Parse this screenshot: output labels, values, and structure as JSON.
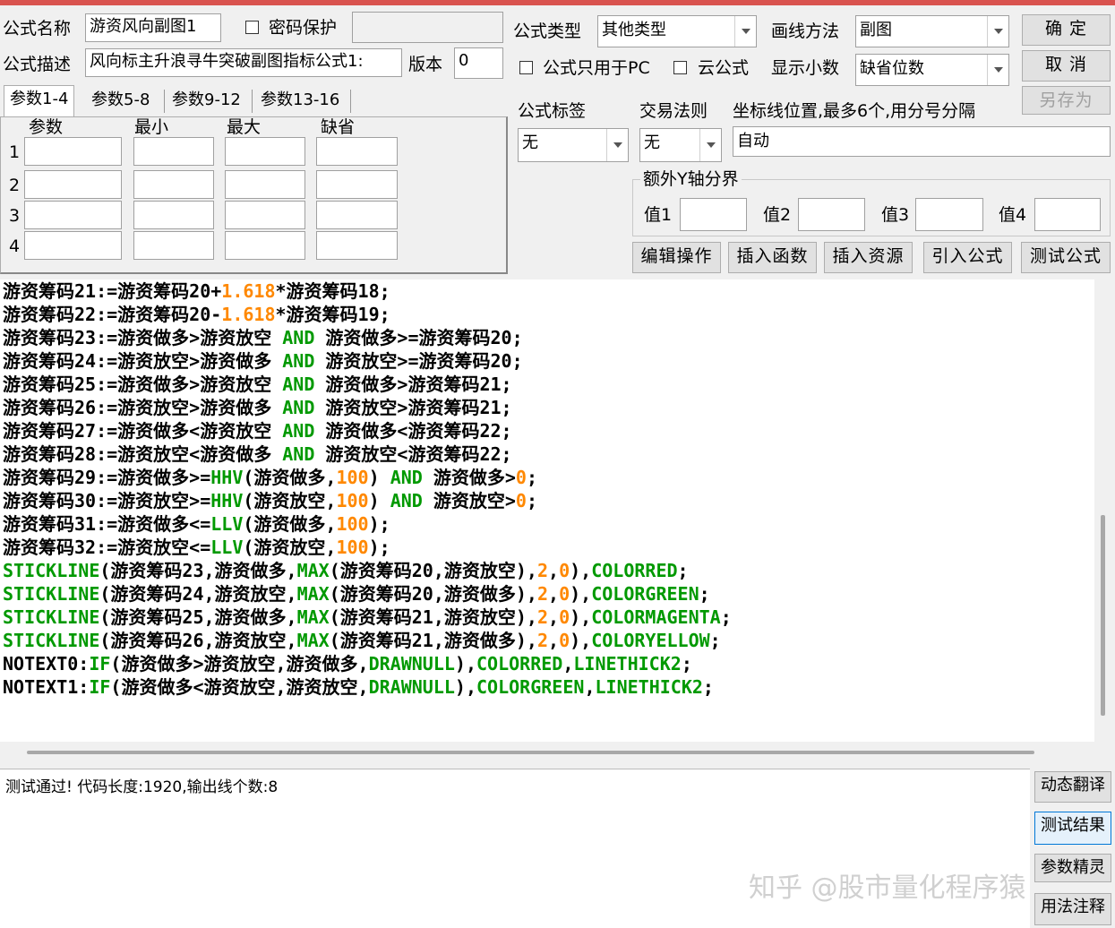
{
  "form": {
    "name_label": "公式名称",
    "name_value": "游资风向副图1",
    "password_label": "密码保护",
    "desc_label": "公式描述",
    "desc_value": "风向标主升浪寻牛突破副图指标公式1:",
    "version_label": "版本",
    "version_value": "0",
    "type_label": "公式类型",
    "type_value": "其他类型",
    "draw_label": "画线方法",
    "draw_value": "副图",
    "pc_only_label": "公式只用于PC",
    "cloud_label": "云公式",
    "decimals_label": "显示小数",
    "decimals_value": "缺省位数",
    "tag_label": "公式标签",
    "tag_value": "无",
    "trade_label": "交易法则",
    "trade_value": "无",
    "axis_label": "坐标线位置,最多6个,用分号分隔",
    "axis_value": "自动",
    "yaxis_group_label": "额外Y轴分界",
    "yaxis_values": [
      "值1",
      "值2",
      "值3",
      "值4"
    ]
  },
  "buttons": {
    "ok": "确 定",
    "cancel": "取 消",
    "save_as": "另存为",
    "edit": "编辑操作",
    "insert_func": "插入函数",
    "insert_res": "插入资源",
    "import": "引入公式",
    "test": "测试公式",
    "translate": "动态翻译",
    "test_result": "测试结果",
    "param_wizard": "参数精灵",
    "usage": "用法注释"
  },
  "tabs": [
    "参数1-4",
    "参数5-8",
    "参数9-12",
    "参数13-16"
  ],
  "params": {
    "headers": [
      "参数",
      "最小",
      "最大",
      "缺省"
    ],
    "rows": [
      "1",
      "2",
      "3",
      "4"
    ]
  },
  "code_lines": [
    [
      [
        "游资筹码21:=游资筹码20+",
        "t"
      ],
      [
        "1.618",
        "n"
      ],
      [
        "*游资筹码18;",
        "t"
      ]
    ],
    [
      [
        "游资筹码22:=游资筹码20-",
        "t"
      ],
      [
        "1.618",
        "n"
      ],
      [
        "*游资筹码19;",
        "t"
      ]
    ],
    [
      [
        "游资筹码23:=游资做多>游资放空 ",
        "t"
      ],
      [
        "AND",
        "k"
      ],
      [
        " 游资做多>=游资筹码20;",
        "t"
      ]
    ],
    [
      [
        "游资筹码24:=游资放空>游资做多 ",
        "t"
      ],
      [
        "AND",
        "k"
      ],
      [
        " 游资放空>=游资筹码20;",
        "t"
      ]
    ],
    [
      [
        "游资筹码25:=游资做多>游资放空 ",
        "t"
      ],
      [
        "AND",
        "k"
      ],
      [
        " 游资做多>游资筹码21;",
        "t"
      ]
    ],
    [
      [
        "游资筹码26:=游资放空>游资做多 ",
        "t"
      ],
      [
        "AND",
        "k"
      ],
      [
        " 游资放空>游资筹码21;",
        "t"
      ]
    ],
    [
      [
        "游资筹码27:=游资做多<游资放空 ",
        "t"
      ],
      [
        "AND",
        "k"
      ],
      [
        " 游资做多<游资筹码22;",
        "t"
      ]
    ],
    [
      [
        "游资筹码28:=游资放空<游资做多 ",
        "t"
      ],
      [
        "AND",
        "k"
      ],
      [
        " 游资放空<游资筹码22;",
        "t"
      ]
    ],
    [
      [
        "游资筹码29:=游资做多>=",
        "t"
      ],
      [
        "HHV",
        "k"
      ],
      [
        "(游资做多,",
        "t"
      ],
      [
        "100",
        "n"
      ],
      [
        ") ",
        "t"
      ],
      [
        "AND",
        "k"
      ],
      [
        " 游资做多>",
        "t"
      ],
      [
        "0",
        "n"
      ],
      [
        ";",
        "t"
      ]
    ],
    [
      [
        "游资筹码30:=游资放空>=",
        "t"
      ],
      [
        "HHV",
        "k"
      ],
      [
        "(游资放空,",
        "t"
      ],
      [
        "100",
        "n"
      ],
      [
        ") ",
        "t"
      ],
      [
        "AND",
        "k"
      ],
      [
        " 游资放空>",
        "t"
      ],
      [
        "0",
        "n"
      ],
      [
        ";",
        "t"
      ]
    ],
    [
      [
        "游资筹码31:=游资做多<=",
        "t"
      ],
      [
        "LLV",
        "k"
      ],
      [
        "(游资做多,",
        "t"
      ],
      [
        "100",
        "n"
      ],
      [
        ");",
        "t"
      ]
    ],
    [
      [
        "游资筹码32:=游资放空<=",
        "t"
      ],
      [
        "LLV",
        "k"
      ],
      [
        "(游资放空,",
        "t"
      ],
      [
        "100",
        "n"
      ],
      [
        ");",
        "t"
      ]
    ],
    [
      [
        "STICKLINE",
        "k"
      ],
      [
        "(游资筹码23,游资做多,",
        "t"
      ],
      [
        "MAX",
        "k"
      ],
      [
        "(游资筹码20,游资放空),",
        "t"
      ],
      [
        "2",
        "n"
      ],
      [
        ",",
        "t"
      ],
      [
        "0",
        "n"
      ],
      [
        "),",
        "t"
      ],
      [
        "COLORRED",
        "k"
      ],
      [
        ";",
        "t"
      ]
    ],
    [
      [
        "STICKLINE",
        "k"
      ],
      [
        "(游资筹码24,游资放空,",
        "t"
      ],
      [
        "MAX",
        "k"
      ],
      [
        "(游资筹码20,游资做多),",
        "t"
      ],
      [
        "2",
        "n"
      ],
      [
        ",",
        "t"
      ],
      [
        "0",
        "n"
      ],
      [
        "),",
        "t"
      ],
      [
        "COLORGREEN",
        "k"
      ],
      [
        ";",
        "t"
      ]
    ],
    [
      [
        "STICKLINE",
        "k"
      ],
      [
        "(游资筹码25,游资做多,",
        "t"
      ],
      [
        "MAX",
        "k"
      ],
      [
        "(游资筹码21,游资放空),",
        "t"
      ],
      [
        "2",
        "n"
      ],
      [
        ",",
        "t"
      ],
      [
        "0",
        "n"
      ],
      [
        "),",
        "t"
      ],
      [
        "COLORMAGENTA",
        "k"
      ],
      [
        ";",
        "t"
      ]
    ],
    [
      [
        "STICKLINE",
        "k"
      ],
      [
        "(游资筹码26,游资放空,",
        "t"
      ],
      [
        "MAX",
        "k"
      ],
      [
        "(游资筹码21,游资做多),",
        "t"
      ],
      [
        "2",
        "n"
      ],
      [
        ",",
        "t"
      ],
      [
        "0",
        "n"
      ],
      [
        "),",
        "t"
      ],
      [
        "COLORYELLOW",
        "k"
      ],
      [
        ";",
        "t"
      ]
    ],
    [
      [
        "NOTEXT0:",
        "t"
      ],
      [
        "IF",
        "k"
      ],
      [
        "(游资做多>游资放空,游资做多,",
        "t"
      ],
      [
        "DRAWNULL",
        "k"
      ],
      [
        "),",
        "t"
      ],
      [
        "COLORRED",
        "k"
      ],
      [
        ",",
        "t"
      ],
      [
        "LINETHICK2",
        "k"
      ],
      [
        ";",
        "t"
      ]
    ],
    [
      [
        "NOTEXT1:",
        "t"
      ],
      [
        "IF",
        "k"
      ],
      [
        "(游资做多<游资放空,游资放空,",
        "t"
      ],
      [
        "DRAWNULL",
        "k"
      ],
      [
        "),",
        "t"
      ],
      [
        "COLORGREEN",
        "k"
      ],
      [
        ",",
        "t"
      ],
      [
        "LINETHICK2",
        "k"
      ],
      [
        ";",
        "t"
      ]
    ]
  ],
  "output": {
    "message": "测试通过! 代码长度:1920,输出线个数:8"
  },
  "watermark": "知乎 @股市量化程序猿",
  "colors": {
    "keyword": "#009900",
    "number": "#ff8800",
    "accent": "#d9534f"
  }
}
